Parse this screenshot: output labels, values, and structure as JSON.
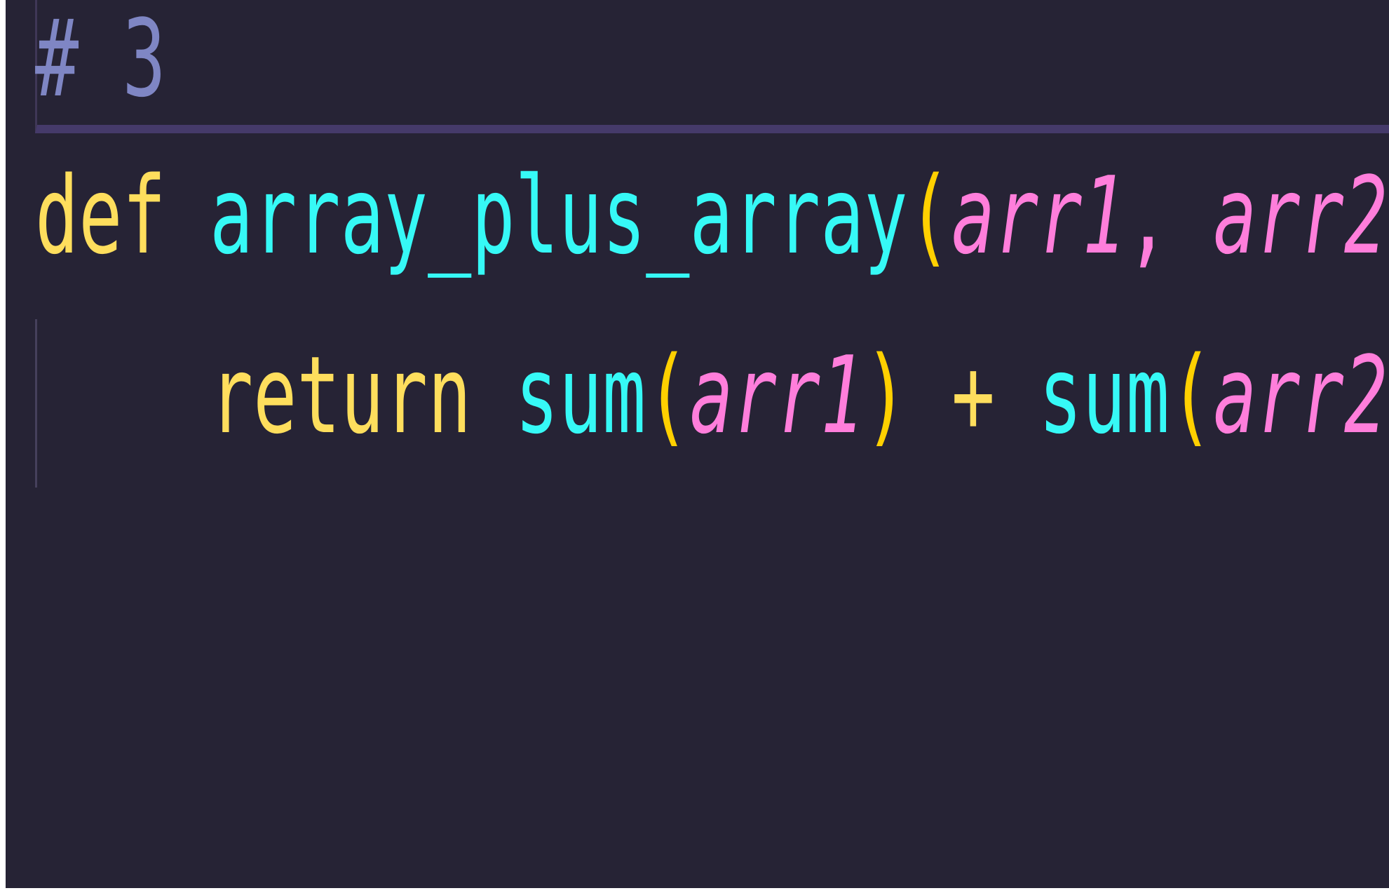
{
  "editor": {
    "background": "#262335",
    "lines": {
      "comment": "# 3",
      "def_keyword": "def",
      "function_name": "array_plus_array",
      "open_paren": "(",
      "param1": "arr1",
      "comma": ",",
      "param2": "arr2",
      "close_paren": ")",
      "colon": ":",
      "return_keyword": "return",
      "builtin_sum": "sum",
      "plus": "+"
    }
  }
}
